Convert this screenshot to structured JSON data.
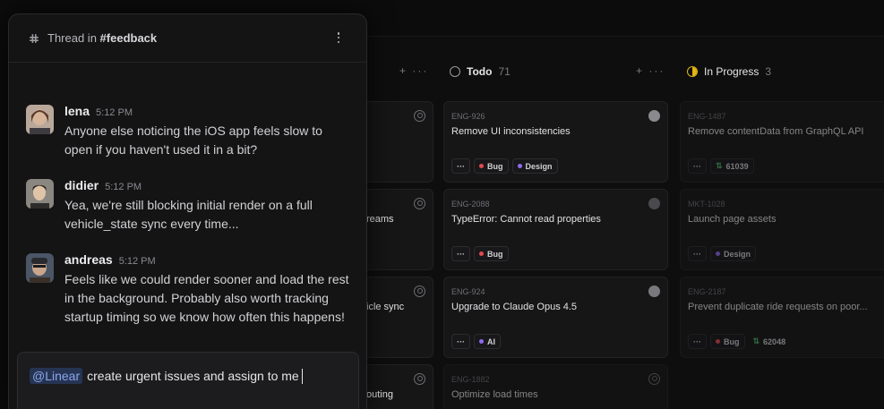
{
  "thread": {
    "prefix": "Thread in",
    "channel": "#feedback",
    "messages": [
      {
        "name": "lena",
        "time": "5:12 PM",
        "text": "Anyone else noticing the iOS app feels slow to open if you haven't used it in a bit?"
      },
      {
        "name": "didier",
        "time": "5:12 PM",
        "text": "Yea, we're still blocking initial render on a full vehicle_state sync every time..."
      },
      {
        "name": "andreas",
        "time": "5:12 PM",
        "text": "Feels like we could render sooner and load the rest in the background. Probably also worth tracking startup timing so we know how often this happens!"
      }
    ],
    "composer": {
      "mention": "@Linear",
      "text": "create urgent issues and assign to me"
    }
  },
  "board": {
    "partial_titles": [
      "reams",
      "icle sync",
      "outing"
    ],
    "left_actions": "+ ···",
    "columns": [
      {
        "title": "Todo",
        "count": "71",
        "actions": "+ ···",
        "cards": [
          {
            "id": "ENG-926",
            "title": "Remove UI inconsistencies",
            "labels": [
              {
                "text": "Bug",
                "color": "#e5484d"
              },
              {
                "text": "Design",
                "color": "#8e6cf0"
              }
            ]
          },
          {
            "id": "ENG-2088",
            "title": "TypeError: Cannot read properties",
            "labels": [
              {
                "text": "Bug",
                "color": "#e5484d"
              }
            ]
          },
          {
            "id": "ENG-924",
            "title": "Upgrade to Claude Opus 4.5",
            "labels": [
              {
                "text": "AI",
                "color": "#8e6cf0"
              }
            ]
          },
          {
            "id": "ENG-1882",
            "title": "Optimize load times",
            "labels": []
          }
        ]
      },
      {
        "title": "In Progress",
        "count": "3",
        "cards": [
          {
            "id": "ENG-1487",
            "title": "Remove contentData from GraphQL API",
            "pr": "61039",
            "labels": []
          },
          {
            "id": "MKT-1028",
            "title": "Launch page assets",
            "labels": [
              {
                "text": "Design",
                "color": "#8e6cf0"
              }
            ]
          },
          {
            "id": "ENG-2187",
            "title": "Prevent duplicate ride requests on poor...",
            "labels": [
              {
                "text": "Bug",
                "color": "#e5484d"
              }
            ],
            "pr": "62048"
          }
        ]
      }
    ]
  },
  "colors": {
    "in_progress": "#e2b714",
    "mention_bg": "#263454",
    "pr_green": "#4fb36a"
  }
}
